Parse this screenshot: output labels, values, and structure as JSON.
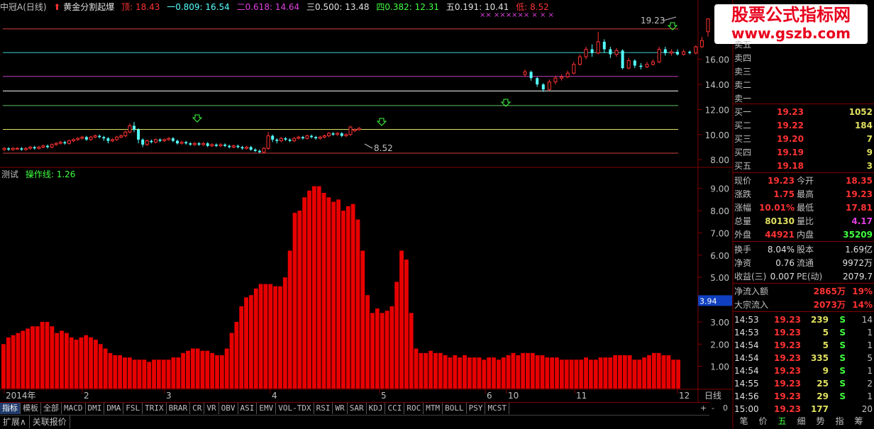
{
  "header": {
    "stock": "中冠A(日线)",
    "indicator": "黄金分割起爆",
    "top": "顶: 18.43",
    "l0809": "一0.809: 16.54",
    "l0618": "二0.618: 14.64",
    "l0500": "三0.500: 13.48",
    "l0382": "四0.382: 12.31",
    "l0191": "五0.191: 10.41",
    "low": "低: 8.52"
  },
  "colors": {
    "up": "#ff3232",
    "down": "#54ffff",
    "bar": "#e80000",
    "grid": "#800000"
  },
  "price_axis": {
    "labels": [
      "16.00",
      "14.00",
      "12.00",
      "10.00",
      "8.00"
    ],
    "partial": "1"
  },
  "price_annotations": {
    "high": "19.23",
    "low": "8.52"
  },
  "fib_levels": [
    {
      "value": 18.43,
      "color": "#d04040"
    },
    {
      "value": 16.54,
      "color": "#40d0d0"
    },
    {
      "value": 14.64,
      "color": "#c040c0"
    },
    {
      "value": 13.48,
      "color": "#ffffff"
    },
    {
      "value": 12.31,
      "color": "#60c060"
    },
    {
      "value": 10.41,
      "color": "#e0e060"
    },
    {
      "value": 8.52,
      "color": "#d04040"
    }
  ],
  "indicator_panel": {
    "name": "测试",
    "line_label": "操作线: 1.26",
    "current_value": "3.94"
  },
  "indicator_axis": {
    "labels": [
      "9.00",
      "8.00",
      "7.00",
      "6.00",
      "5.00",
      "4.00",
      "3.00",
      "2.00",
      "1.00"
    ]
  },
  "chart_data": {
    "type": "bar",
    "title": "操作线",
    "ylim": [
      0,
      9.5
    ],
    "values": [
      2.0,
      2.3,
      2.4,
      2.5,
      2.6,
      2.7,
      2.8,
      2.8,
      3.0,
      3.0,
      2.8,
      2.5,
      2.6,
      2.5,
      2.3,
      2.2,
      2.3,
      2.4,
      2.3,
      2.2,
      2.0,
      1.8,
      1.6,
      1.5,
      1.5,
      1.4,
      1.4,
      1.3,
      1.3,
      1.3,
      1.2,
      1.3,
      1.3,
      1.3,
      1.3,
      1.4,
      1.4,
      1.6,
      1.7,
      1.8,
      1.8,
      1.7,
      1.7,
      1.6,
      1.5,
      1.5,
      1.8,
      2.5,
      3.0,
      3.7,
      4.1,
      4.2,
      4.5,
      4.7,
      4.7,
      4.7,
      4.6,
      4.6,
      5.0,
      6.2,
      7.9,
      8.0,
      8.6,
      8.9,
      9.1,
      9.1,
      8.8,
      8.6,
      8.4,
      8.5,
      8.0,
      8.2,
      8.3,
      7.6,
      6.2,
      4.2,
      3.4,
      3.6,
      3.4,
      3.5,
      3.7,
      4.8,
      6.2,
      5.8,
      3.4,
      1.8,
      1.6,
      1.6,
      1.7,
      1.6,
      1.6,
      1.5,
      1.4,
      1.5,
      1.4,
      1.5,
      1.4,
      1.4,
      1.4,
      1.3,
      1.4,
      1.4,
      1.3,
      1.4,
      1.5,
      1.6,
      1.5,
      1.6,
      1.6,
      1.6,
      1.5,
      1.5,
      1.4,
      1.4,
      1.4,
      1.3,
      1.3,
      1.3,
      1.3,
      1.3,
      1.4,
      1.3,
      1.3,
      1.4,
      1.4,
      1.4,
      1.5,
      1.5,
      1.5,
      1.5,
      1.3,
      1.3,
      1.4,
      1.5,
      1.6,
      1.6,
      1.5,
      1.5,
      1.3,
      1.3
    ]
  },
  "candles": [
    {
      "o": 8.8,
      "c": 8.9,
      "h": 9.0,
      "l": 8.7
    },
    {
      "o": 8.9,
      "c": 8.8,
      "h": 9.0,
      "l": 8.7
    },
    {
      "o": 8.8,
      "c": 8.9,
      "h": 9.0,
      "l": 8.7
    },
    {
      "o": 8.9,
      "c": 8.9,
      "h": 9.0,
      "l": 8.8
    },
    {
      "o": 8.9,
      "c": 8.8,
      "h": 9.0,
      "l": 8.7
    },
    {
      "o": 8.8,
      "c": 8.9,
      "h": 9.0,
      "l": 8.7
    },
    {
      "o": 8.9,
      "c": 9.0,
      "h": 9.1,
      "l": 8.8
    },
    {
      "o": 9.0,
      "c": 8.9,
      "h": 9.1,
      "l": 8.8
    },
    {
      "o": 8.9,
      "c": 9.0,
      "h": 9.1,
      "l": 8.8
    },
    {
      "o": 9.0,
      "c": 9.1,
      "h": 9.2,
      "l": 8.9
    },
    {
      "o": 9.1,
      "c": 9.0,
      "h": 9.2,
      "l": 8.9
    },
    {
      "o": 9.0,
      "c": 9.2,
      "h": 9.3,
      "l": 8.9
    },
    {
      "o": 9.2,
      "c": 9.3,
      "h": 9.4,
      "l": 9.1
    },
    {
      "o": 9.3,
      "c": 9.4,
      "h": 9.5,
      "l": 9.2
    },
    {
      "o": 9.4,
      "c": 9.3,
      "h": 9.5,
      "l": 9.2
    },
    {
      "o": 9.3,
      "c": 9.5,
      "h": 9.6,
      "l": 9.2
    },
    {
      "o": 9.5,
      "c": 9.6,
      "h": 9.7,
      "l": 9.4
    },
    {
      "o": 9.6,
      "c": 9.7,
      "h": 9.8,
      "l": 9.5
    },
    {
      "o": 9.7,
      "c": 9.8,
      "h": 9.9,
      "l": 9.6
    },
    {
      "o": 9.8,
      "c": 9.6,
      "h": 9.9,
      "l": 9.5
    },
    {
      "o": 9.6,
      "c": 9.8,
      "h": 9.9,
      "l": 9.5
    },
    {
      "o": 9.8,
      "c": 9.9,
      "h": 10.0,
      "l": 9.7
    },
    {
      "o": 9.9,
      "c": 9.8,
      "h": 10.0,
      "l": 9.7
    },
    {
      "o": 9.8,
      "c": 9.7,
      "h": 9.9,
      "l": 9.5
    },
    {
      "o": 9.7,
      "c": 9.5,
      "h": 9.8,
      "l": 9.3
    },
    {
      "o": 9.5,
      "c": 9.6,
      "h": 9.7,
      "l": 9.4
    },
    {
      "o": 9.6,
      "c": 9.8,
      "h": 9.9,
      "l": 9.5
    },
    {
      "o": 9.8,
      "c": 9.9,
      "h": 10.0,
      "l": 9.7
    },
    {
      "o": 9.9,
      "c": 10.2,
      "h": 10.3,
      "l": 9.8
    },
    {
      "o": 10.2,
      "c": 10.7,
      "h": 10.9,
      "l": 10.1
    },
    {
      "o": 10.7,
      "c": 10.4,
      "h": 11.0,
      "l": 10.2
    },
    {
      "o": 10.4,
      "c": 9.6,
      "h": 10.5,
      "l": 9.3
    },
    {
      "o": 9.6,
      "c": 9.2,
      "h": 9.7,
      "l": 9.0
    },
    {
      "o": 9.2,
      "c": 9.5,
      "h": 9.6,
      "l": 9.1
    },
    {
      "o": 9.5,
      "c": 9.4,
      "h": 9.6,
      "l": 9.3
    },
    {
      "o": 9.4,
      "c": 9.6,
      "h": 9.7,
      "l": 9.3
    },
    {
      "o": 9.6,
      "c": 9.5,
      "h": 9.7,
      "l": 9.4
    },
    {
      "o": 9.5,
      "c": 9.6,
      "h": 9.7,
      "l": 9.4
    },
    {
      "o": 9.6,
      "c": 9.7,
      "h": 9.8,
      "l": 9.5
    },
    {
      "o": 9.7,
      "c": 9.5,
      "h": 9.8,
      "l": 9.4
    },
    {
      "o": 9.5,
      "c": 9.3,
      "h": 9.6,
      "l": 9.2
    },
    {
      "o": 9.3,
      "c": 9.4,
      "h": 9.5,
      "l": 9.2
    },
    {
      "o": 9.4,
      "c": 9.3,
      "h": 9.5,
      "l": 9.2
    },
    {
      "o": 9.3,
      "c": 9.2,
      "h": 9.4,
      "l": 9.1
    },
    {
      "o": 9.2,
      "c": 9.3,
      "h": 9.4,
      "l": 9.1
    },
    {
      "o": 9.3,
      "c": 9.2,
      "h": 9.4,
      "l": 9.1
    },
    {
      "o": 9.2,
      "c": 9.3,
      "h": 9.4,
      "l": 9.1
    },
    {
      "o": 9.3,
      "c": 9.1,
      "h": 9.4,
      "l": 9.0
    },
    {
      "o": 9.1,
      "c": 9.2,
      "h": 9.3,
      "l": 9.0
    },
    {
      "o": 9.2,
      "c": 9.1,
      "h": 9.3,
      "l": 9.0
    },
    {
      "o": 9.1,
      "c": 9.2,
      "h": 9.3,
      "l": 9.0
    },
    {
      "o": 9.2,
      "c": 9.1,
      "h": 9.3,
      "l": 9.0
    },
    {
      "o": 9.1,
      "c": 9.0,
      "h": 9.2,
      "l": 8.9
    },
    {
      "o": 9.0,
      "c": 9.1,
      "h": 9.2,
      "l": 8.9
    },
    {
      "o": 9.1,
      "c": 9.0,
      "h": 9.2,
      "l": 8.9
    },
    {
      "o": 9.0,
      "c": 8.9,
      "h": 9.1,
      "l": 8.8
    },
    {
      "o": 8.9,
      "c": 9.0,
      "h": 9.1,
      "l": 8.8
    },
    {
      "o": 9.0,
      "c": 8.8,
      "h": 9.1,
      "l": 8.7
    },
    {
      "o": 8.8,
      "c": 8.7,
      "h": 8.9,
      "l": 8.6
    },
    {
      "o": 8.7,
      "c": 8.6,
      "h": 8.8,
      "l": 8.52
    },
    {
      "o": 8.6,
      "c": 8.9,
      "h": 9.0,
      "l": 8.52
    },
    {
      "o": 8.9,
      "c": 9.9,
      "h": 10.2,
      "l": 8.8
    },
    {
      "o": 9.9,
      "c": 9.6,
      "h": 10.0,
      "l": 9.4
    },
    {
      "o": 9.6,
      "c": 9.5,
      "h": 9.7,
      "l": 9.3
    },
    {
      "o": 9.5,
      "c": 9.7,
      "h": 9.8,
      "l": 9.4
    },
    {
      "o": 9.7,
      "c": 9.6,
      "h": 9.8,
      "l": 9.5
    },
    {
      "o": 9.6,
      "c": 9.5,
      "h": 9.7,
      "l": 9.4
    },
    {
      "o": 9.5,
      "c": 9.7,
      "h": 9.8,
      "l": 9.4
    },
    {
      "o": 9.7,
      "c": 9.8,
      "h": 9.9,
      "l": 9.6
    },
    {
      "o": 9.8,
      "c": 9.7,
      "h": 9.9,
      "l": 9.6
    },
    {
      "o": 9.7,
      "c": 9.9,
      "h": 10.0,
      "l": 9.6
    },
    {
      "o": 9.9,
      "c": 9.8,
      "h": 10.0,
      "l": 9.7
    },
    {
      "o": 9.8,
      "c": 9.7,
      "h": 9.9,
      "l": 9.6
    },
    {
      "o": 9.7,
      "c": 9.8,
      "h": 9.9,
      "l": 9.6
    },
    {
      "o": 9.8,
      "c": 9.9,
      "h": 10.0,
      "l": 9.7
    },
    {
      "o": 9.9,
      "c": 10.1,
      "h": 10.2,
      "l": 9.8
    },
    {
      "o": 10.1,
      "c": 10.0,
      "h": 10.2,
      "l": 9.9
    },
    {
      "o": 10.0,
      "c": 10.1,
      "h": 10.2,
      "l": 9.9
    },
    {
      "o": 10.1,
      "c": 9.9,
      "h": 10.2,
      "l": 9.8
    },
    {
      "o": 9.9,
      "c": 10.0,
      "h": 10.1,
      "l": 9.8
    },
    {
      "o": 10.0,
      "c": 10.6,
      "h": 10.7,
      "l": 9.9
    },
    {
      "o": 10.3,
      "c": 10.4,
      "h": 10.5,
      "l": 10.2
    },
    {
      "o": 10.4,
      "c": 10.5,
      "h": 10.6,
      "l": 10.3
    },
    {
      "o": 14.8,
      "c": 15.0,
      "h": 15.2,
      "l": 14.6
    },
    {
      "o": 15.0,
      "c": 14.5,
      "h": 15.1,
      "l": 14.3
    },
    {
      "o": 14.5,
      "c": 14.0,
      "h": 14.6,
      "l": 13.8
    },
    {
      "o": 14.0,
      "c": 13.6,
      "h": 14.1,
      "l": 13.4
    },
    {
      "o": 13.6,
      "c": 14.2,
      "h": 14.4,
      "l": 13.5
    },
    {
      "o": 14.2,
      "c": 14.5,
      "h": 14.7,
      "l": 14.0
    },
    {
      "o": 14.5,
      "c": 14.6,
      "h": 14.8,
      "l": 14.3
    },
    {
      "o": 14.6,
      "c": 14.9,
      "h": 15.1,
      "l": 14.5
    },
    {
      "o": 14.9,
      "c": 15.6,
      "h": 15.8,
      "l": 14.8
    },
    {
      "o": 15.6,
      "c": 16.2,
      "h": 16.4,
      "l": 15.5
    },
    {
      "o": 16.2,
      "c": 16.8,
      "h": 17.0,
      "l": 16.0
    },
    {
      "o": 16.8,
      "c": 16.5,
      "h": 17.2,
      "l": 16.2
    },
    {
      "o": 16.5,
      "c": 17.4,
      "h": 18.2,
      "l": 16.4
    },
    {
      "o": 17.4,
      "c": 16.8,
      "h": 17.6,
      "l": 16.5
    },
    {
      "o": 16.8,
      "c": 16.4,
      "h": 17.0,
      "l": 16.1
    },
    {
      "o": 16.4,
      "c": 16.7,
      "h": 16.9,
      "l": 16.2
    },
    {
      "o": 16.7,
      "c": 15.3,
      "h": 16.8,
      "l": 15.2
    },
    {
      "o": 15.3,
      "c": 15.9,
      "h": 16.1,
      "l": 15.2
    },
    {
      "o": 15.9,
      "c": 15.5,
      "h": 16.0,
      "l": 15.3
    },
    {
      "o": 15.5,
      "c": 15.4,
      "h": 15.7,
      "l": 15.2
    },
    {
      "o": 15.4,
      "c": 15.6,
      "h": 15.8,
      "l": 15.3
    },
    {
      "o": 15.6,
      "c": 15.8,
      "h": 16.0,
      "l": 15.5
    },
    {
      "o": 15.8,
      "c": 16.8,
      "h": 17.0,
      "l": 15.7
    },
    {
      "o": 16.8,
      "c": 16.5,
      "h": 17.0,
      "l": 16.3
    },
    {
      "o": 16.5,
      "c": 16.6,
      "h": 16.8,
      "l": 16.3
    },
    {
      "o": 16.6,
      "c": 16.4,
      "h": 16.8,
      "l": 16.3
    },
    {
      "o": 16.4,
      "c": 16.6,
      "h": 16.8,
      "l": 16.3
    },
    {
      "o": 16.6,
      "c": 16.5,
      "h": 16.7,
      "l": 16.4
    },
    {
      "o": 16.5,
      "c": 17.0,
      "h": 17.1,
      "l": 16.4
    },
    {
      "o": 17.0,
      "c": 17.5,
      "h": 17.8,
      "l": 16.9
    },
    {
      "o": 18.2,
      "c": 19.23,
      "h": 19.23,
      "l": 17.81
    }
  ],
  "signals": {
    "top_markers": "××  ××××××  ×  ×   ×",
    "x_positions": [
      678,
      701,
      787,
      857,
      877
    ]
  },
  "time_axis": {
    "labels": [
      "2014年",
      "2",
      "3",
      "4",
      "5",
      "6",
      "10",
      "11",
      "12"
    ]
  },
  "tabs": [
    "指标",
    "模板",
    "全部",
    "MACD",
    "DMI",
    "DMA",
    "FSL",
    "TRIX",
    "BRAR",
    "CR",
    "VR",
    "OBV",
    "ASI",
    "EMV",
    "VOL-TDX",
    "RSI",
    "WR",
    "SAR",
    "KDJ",
    "CCI",
    "ROC",
    "MTM",
    "BOLL",
    "PSY",
    "MCST"
  ],
  "bottom_tabs": [
    "扩展∧",
    "关联报价"
  ],
  "period": "日线",
  "zoom_controls": [
    "+",
    "-",
    "0"
  ],
  "watermark": {
    "line1": "股票公式指标网",
    "line2": "www.gszb.com"
  },
  "orderbook": {
    "sell": [
      {
        "label": "卖五"
      },
      {
        "label": "卖四"
      },
      {
        "label": "卖三"
      },
      {
        "label": "卖二"
      },
      {
        "label": "卖一"
      }
    ],
    "buy": [
      {
        "label": "买一",
        "price": "19.23",
        "vol": "1052"
      },
      {
        "label": "买二",
        "price": "19.22",
        "vol": "184"
      },
      {
        "label": "买三",
        "price": "19.20",
        "vol": "7"
      },
      {
        "label": "买四",
        "price": "19.19",
        "vol": "9"
      },
      {
        "label": "买五",
        "price": "19.18",
        "vol": "3"
      }
    ]
  },
  "quote": [
    {
      "l1": "现价",
      "v1": "19.23",
      "l2": "今开",
      "v2": "18.35",
      "c1": "#ff3232",
      "c2": "#ff3232"
    },
    {
      "l1": "涨跌",
      "v1": "1.75",
      "l2": "最高",
      "v2": "19.23",
      "c1": "#ff3232",
      "c2": "#ff3232"
    },
    {
      "l1": "涨幅",
      "v1": "10.01%",
      "l2": "最低",
      "v2": "17.81",
      "c1": "#ff3232",
      "c2": "#ff3232"
    },
    {
      "l1": "总量",
      "v1": "80130",
      "l2": "量比",
      "v2": "4.17",
      "c1": "#e0e060",
      "c2": "#e040e0"
    },
    {
      "l1": "外盘",
      "v1": "44921",
      "l2": "内盘",
      "v2": "35209",
      "c1": "#ff3232",
      "c2": "#40ff40"
    }
  ],
  "fundamentals": [
    {
      "l1": "换手",
      "v1": "8.04%",
      "l2": "股本",
      "v2": "1.69亿"
    },
    {
      "l1": "净资",
      "v1": "0.76",
      "l2": "流通",
      "v2": "9972万"
    },
    {
      "l1": "收益(三)",
      "v1": "0.007",
      "l2": "PE(动)",
      "v2": "2079.7"
    }
  ],
  "flows": [
    {
      "label": "净流入额",
      "value": "2865万",
      "pct": "19%"
    },
    {
      "label": "大宗流入",
      "value": "2073万",
      "pct": "14%"
    }
  ],
  "ticks": [
    {
      "t": "14:53",
      "p": "19.23",
      "v": "239",
      "d": "S",
      "n": "14"
    },
    {
      "t": "14:53",
      "p": "19.23",
      "v": "5",
      "d": "S",
      "n": "1"
    },
    {
      "t": "14:54",
      "p": "19.23",
      "v": "5",
      "d": "S",
      "n": "1"
    },
    {
      "t": "14:54",
      "p": "19.23",
      "v": "335",
      "d": "S",
      "n": "5"
    },
    {
      "t": "14:54",
      "p": "19.23",
      "v": "9",
      "d": "S",
      "n": "1"
    },
    {
      "t": "14:55",
      "p": "19.23",
      "v": "25",
      "d": "S",
      "n": "2"
    },
    {
      "t": "14:56",
      "p": "19.23",
      "v": "29",
      "d": "S",
      "n": "1"
    },
    {
      "t": "15:00",
      "p": "19.23",
      "v": "177",
      "d": "",
      "n": "20"
    }
  ],
  "footer_right": [
    "笔",
    "价",
    "五",
    "细",
    "势",
    "指",
    "筹"
  ]
}
